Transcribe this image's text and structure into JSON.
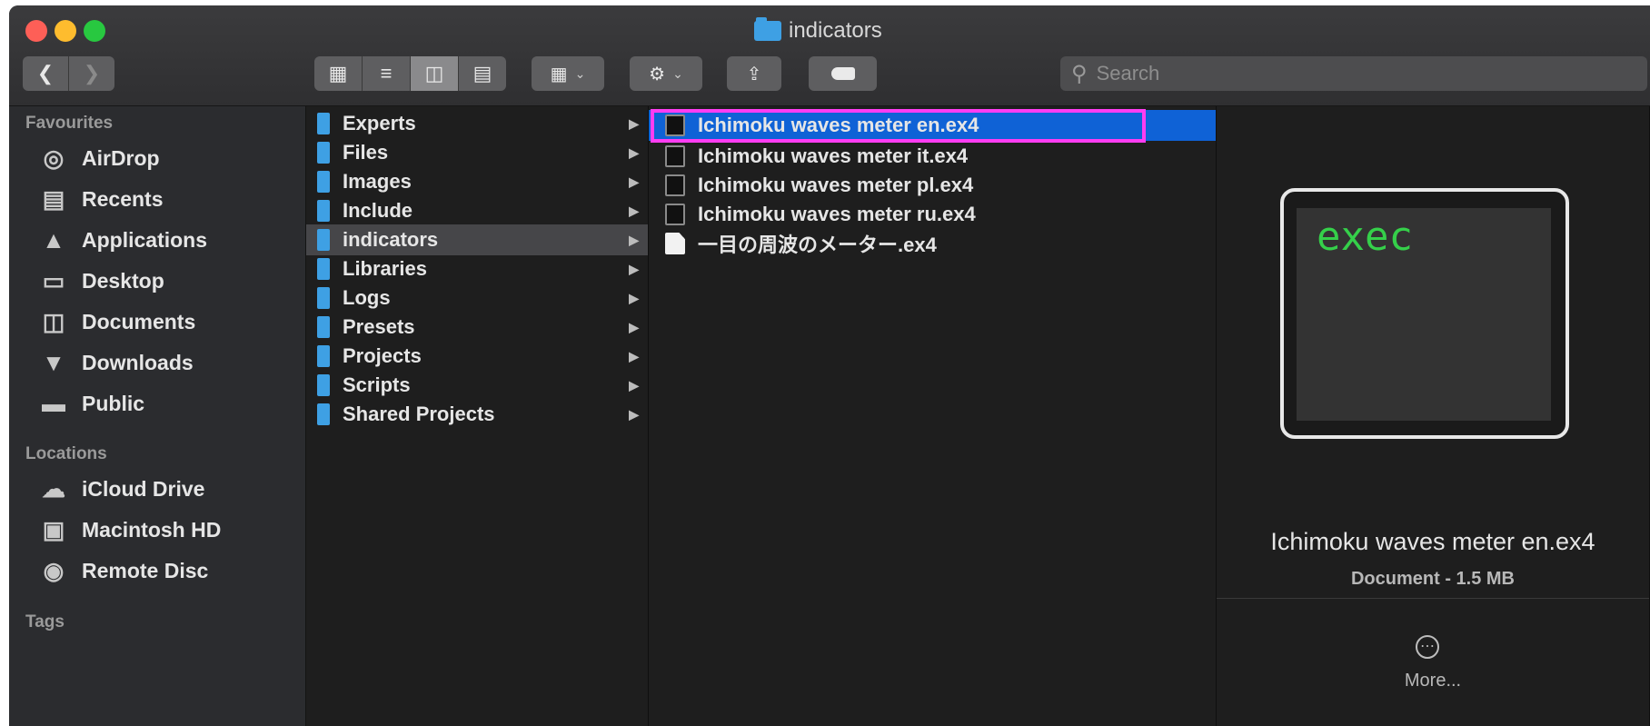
{
  "window": {
    "title": "indicators"
  },
  "toolbar": {
    "back_icon": "chevron-left-icon",
    "forward_icon": "chevron-right-icon",
    "view_icons": [
      "grid-view-icon",
      "list-view-icon",
      "column-view-icon",
      "gallery-view-icon"
    ],
    "group_icon": "group-by-icon",
    "action_icon": "gear-icon",
    "share_icon": "share-icon",
    "tag_icon": "tag-icon",
    "search_placeholder": "Search"
  },
  "sidebar": {
    "favourites_header": "Favourites",
    "favourites": [
      {
        "label": "AirDrop",
        "icon": "airdrop-icon"
      },
      {
        "label": "Recents",
        "icon": "recents-icon"
      },
      {
        "label": "Applications",
        "icon": "applications-icon"
      },
      {
        "label": "Desktop",
        "icon": "desktop-icon"
      },
      {
        "label": "Documents",
        "icon": "documents-icon"
      },
      {
        "label": "Downloads",
        "icon": "downloads-icon"
      },
      {
        "label": "Public",
        "icon": "folder-icon"
      }
    ],
    "locations_header": "Locations",
    "locations": [
      {
        "label": "iCloud Drive",
        "icon": "cloud-icon"
      },
      {
        "label": "Macintosh HD",
        "icon": "hard-drive-icon"
      },
      {
        "label": "Remote Disc",
        "icon": "disc-icon"
      }
    ],
    "tags_header": "Tags"
  },
  "column1": {
    "items": [
      "Experts",
      "Files",
      "Images",
      "Include",
      "indicators",
      "Libraries",
      "Logs",
      "Presets",
      "Projects",
      "Scripts",
      "Shared Projects"
    ],
    "highlighted": "indicators"
  },
  "column2": {
    "items": [
      "Ichimoku waves meter en.ex4",
      "Ichimoku waves meter it.ex4",
      "Ichimoku waves meter pl.ex4",
      "Ichimoku waves meter ru.ex4",
      "一目の周波のメーター.ex4"
    ],
    "selected": "Ichimoku waves meter en.ex4"
  },
  "preview": {
    "icon_text": "exec",
    "name": "Ichimoku waves meter en.ex4",
    "meta": "Document - 1.5 MB",
    "more_label": "More..."
  },
  "colors": {
    "selection": "#0f62d6",
    "annotation_box": "#ff3df2",
    "folder": "#3ea0e4",
    "exec_text": "#35d04a"
  }
}
